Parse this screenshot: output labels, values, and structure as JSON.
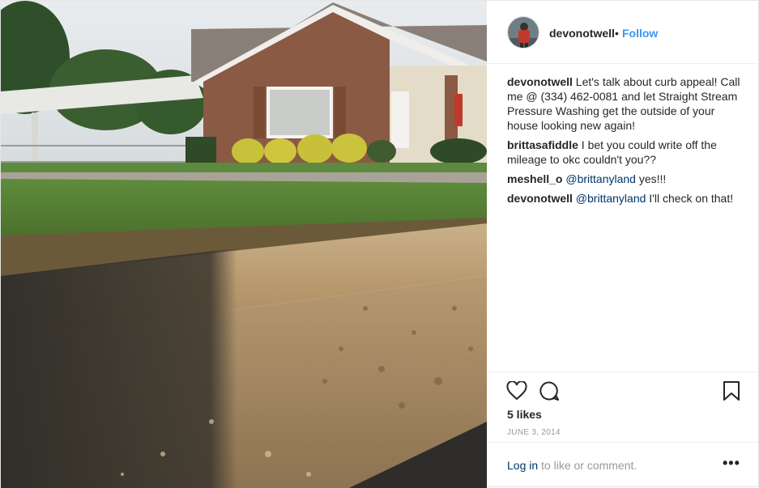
{
  "post": {
    "photo_alt": "",
    "author": {
      "username": "devonotwell",
      "separator": "•",
      "follow_label": "Follow"
    },
    "comments": [
      {
        "username": "devonotwell",
        "text": " Let's talk about curb appeal! Call me @ (334) 462-0081 and let Straight Stream Pressure Washing get the outside of your house looking new again!",
        "mention": ""
      },
      {
        "username": "brittasafiddle",
        "text": " I bet you could write off the mileage to okc couldn't you??",
        "mention": ""
      },
      {
        "username": "meshell_o",
        "mention": " @brittanyland",
        "text": " yes!!!"
      },
      {
        "username": "devonotwell",
        "mention": " @brittanyland",
        "text": " I'll check on that!"
      }
    ],
    "actions": {
      "like_icon": "heart-icon",
      "comment_icon": "speech-bubble-icon",
      "save_icon": "bookmark-icon"
    },
    "likes": "5 likes",
    "date": "JUNE 3, 2014",
    "footer": {
      "login_link": "Log in",
      "login_text": " to like or comment.",
      "more_label": "•••"
    }
  },
  "colors": {
    "link_blue": "#3897f0",
    "mention_blue": "#003569",
    "muted": "#999999"
  }
}
